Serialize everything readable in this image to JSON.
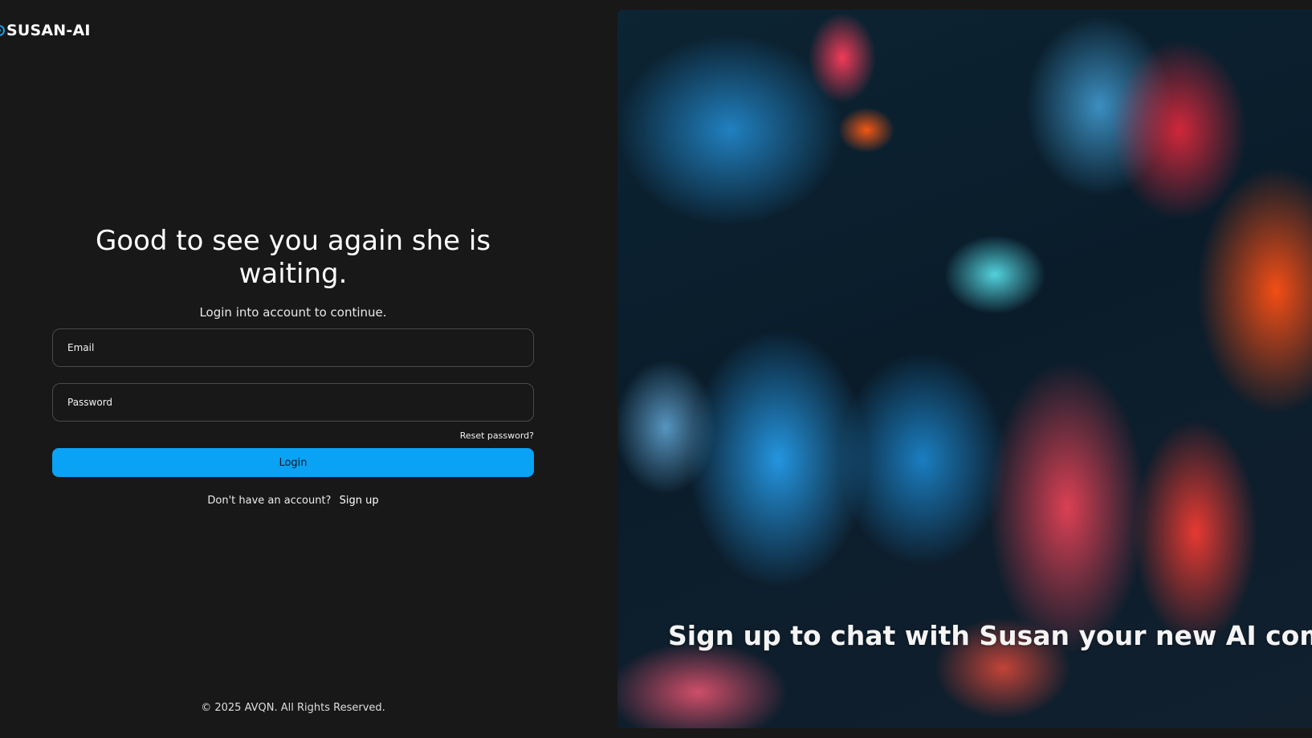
{
  "brand": {
    "name": "SUSAN-AI",
    "icon": "circle-logo-icon",
    "accent_color": "#1a9be8"
  },
  "login": {
    "headline": "Good to see you again she is waiting.",
    "subhead": "Login into account to continue.",
    "email_placeholder": "Email",
    "password_placeholder": "Password",
    "reset_label": "Reset password?",
    "login_label": "Login",
    "login_button_color": "#0aa2f5",
    "no_account_text": "Don't have an account?",
    "signup_label": "Sign up"
  },
  "footer": {
    "copyright": "© 2025 AVQN. All Rights Reserved."
  },
  "hero": {
    "caption": "Sign up to chat with Susan your new AI companion"
  }
}
